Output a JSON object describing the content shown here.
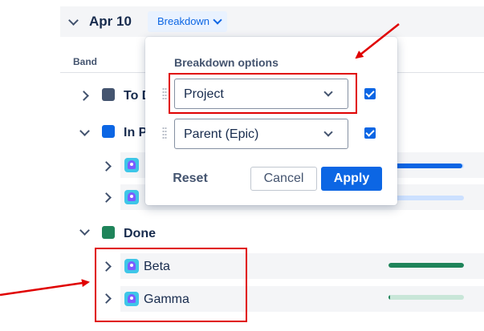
{
  "header": {
    "date": "Apr 10",
    "breakdown_label": "Breakdown"
  },
  "table": {
    "column_band": "Band"
  },
  "groups": [
    {
      "label": "To D",
      "color": "#44546f"
    },
    {
      "label": "In P",
      "color": "#0c66e4"
    },
    {
      "label": "Done",
      "color": "#1f845a"
    }
  ],
  "in_progress_items": [
    {
      "label": "",
      "progress": 0.98
    },
    {
      "label": "",
      "progress": 0.0
    }
  ],
  "done_items": [
    {
      "label": "Beta",
      "progress": 1.0
    },
    {
      "label": "Gamma",
      "progress": 0.02
    }
  ],
  "popup": {
    "title": "Breakdown options",
    "options": [
      {
        "value": "Project",
        "checked": true
      },
      {
        "value": "Parent (Epic)",
        "checked": true
      }
    ],
    "reset_label": "Reset",
    "cancel_label": "Cancel",
    "apply_label": "Apply"
  },
  "colors": {
    "accent": "#0c66e4",
    "done": "#1f845a",
    "annotation": "#e00000"
  }
}
